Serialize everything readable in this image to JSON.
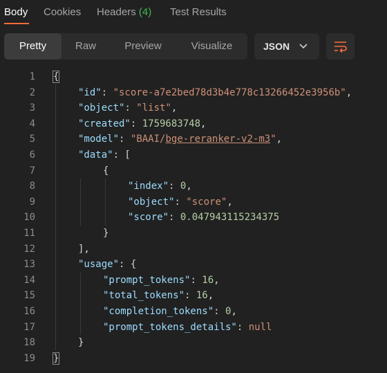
{
  "tabs": [
    {
      "label": "Body"
    },
    {
      "label": "Cookies"
    },
    {
      "label": "Headers",
      "count": "(4)"
    },
    {
      "label": "Test Results"
    }
  ],
  "view_modes": [
    "Pretty",
    "Raw",
    "Preview",
    "Visualize"
  ],
  "active_view": "Pretty",
  "format": {
    "selected": "JSON",
    "chevron_icon": "chevron-down-icon"
  },
  "wrap_icon": "text-wrap-icon",
  "colors": {
    "accent": "#ff6c37",
    "count": "#3fb950",
    "key": "#9cdcfe",
    "string": "#ce9178",
    "number": "#b5cea8"
  },
  "json": {
    "line_numbers": [
      "1",
      "2",
      "3",
      "4",
      "5",
      "6",
      "7",
      "8",
      "9",
      "10",
      "11",
      "12",
      "13",
      "14",
      "15",
      "16",
      "17",
      "18",
      "19"
    ],
    "id": "\"score-a7e2bed78d3b4e778c13266452e3956b\"",
    "object": "\"list\"",
    "created": "1759683748",
    "model_open_quote": "\"",
    "model_org": "BAAI",
    "model_sep": "/",
    "model_name": "bge-reranker-v2-m3",
    "model_close_quote": "\"",
    "item_index": "0",
    "item_object": "\"score\"",
    "item_score": "0.047943115234375",
    "prompt_tokens": "16",
    "total_tokens": "16",
    "completion_tokens": "0",
    "prompt_tokens_details": "null",
    "keys": {
      "id": "\"id\"",
      "object": "\"object\"",
      "created": "\"created\"",
      "model": "\"model\"",
      "data": "\"data\"",
      "index": "\"index\"",
      "score": "\"score\"",
      "usage": "\"usage\"",
      "prompt_tokens": "\"prompt_tokens\"",
      "total_tokens": "\"total_tokens\"",
      "completion_tokens": "\"completion_tokens\"",
      "prompt_tokens_details": "\"prompt_tokens_details\""
    }
  }
}
